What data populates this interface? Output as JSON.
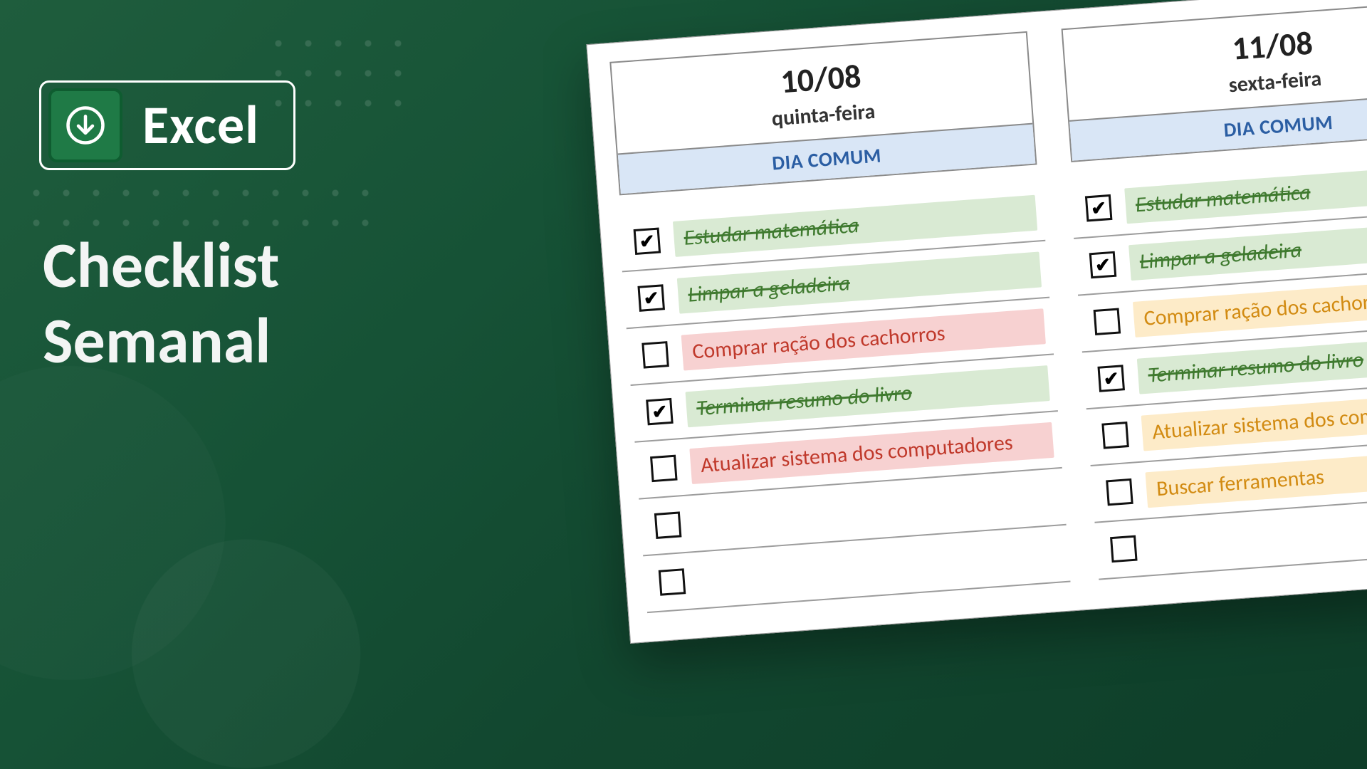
{
  "brand": {
    "label": "Excel",
    "icon_name": "download-arrow-icon"
  },
  "title_line1": "Checklist",
  "title_line2": "Semanal",
  "colors": {
    "bg_green_start": "#1f5d3d",
    "bg_green_end": "#0e3e29",
    "header_blue_bg": "#d9e6f6",
    "header_blue_text": "#2b5ea3",
    "done_bg": "#d9ead3",
    "done_text": "#3f7a2f",
    "warn_bg": "#fdebc8",
    "warn_text": "#d28b12",
    "late_bg": "#f7d1d1",
    "late_text": "#c0392b"
  },
  "days": [
    {
      "date": "10/08",
      "weekday": "quinta-feira",
      "tag": "DIA COMUM",
      "items": [
        {
          "checked": true,
          "status": "done",
          "text": "Estudar matemática"
        },
        {
          "checked": true,
          "status": "done",
          "text": "Limpar a geladeira"
        },
        {
          "checked": false,
          "status": "late",
          "text": "Comprar ração dos cachorros"
        },
        {
          "checked": true,
          "status": "done",
          "text": "Terminar resumo do livro"
        },
        {
          "checked": false,
          "status": "late",
          "text": "Atualizar sistema dos computadores"
        },
        {
          "checked": false,
          "status": "empty",
          "text": ""
        },
        {
          "checked": false,
          "status": "empty",
          "text": ""
        }
      ]
    },
    {
      "date": "11/08",
      "weekday": "sexta-feira",
      "tag": "DIA COMUM",
      "items": [
        {
          "checked": true,
          "status": "done",
          "text": "Estudar matemática"
        },
        {
          "checked": true,
          "status": "done",
          "text": "Limpar a geladeira"
        },
        {
          "checked": false,
          "status": "warn",
          "text": "Comprar ração dos cachorros"
        },
        {
          "checked": true,
          "status": "done",
          "text": "Terminar resumo do livro"
        },
        {
          "checked": false,
          "status": "warn",
          "text": "Atualizar sistema dos computadores"
        },
        {
          "checked": false,
          "status": "warn",
          "text": "Buscar ferramentas"
        },
        {
          "checked": false,
          "status": "empty",
          "text": ""
        }
      ]
    }
  ]
}
